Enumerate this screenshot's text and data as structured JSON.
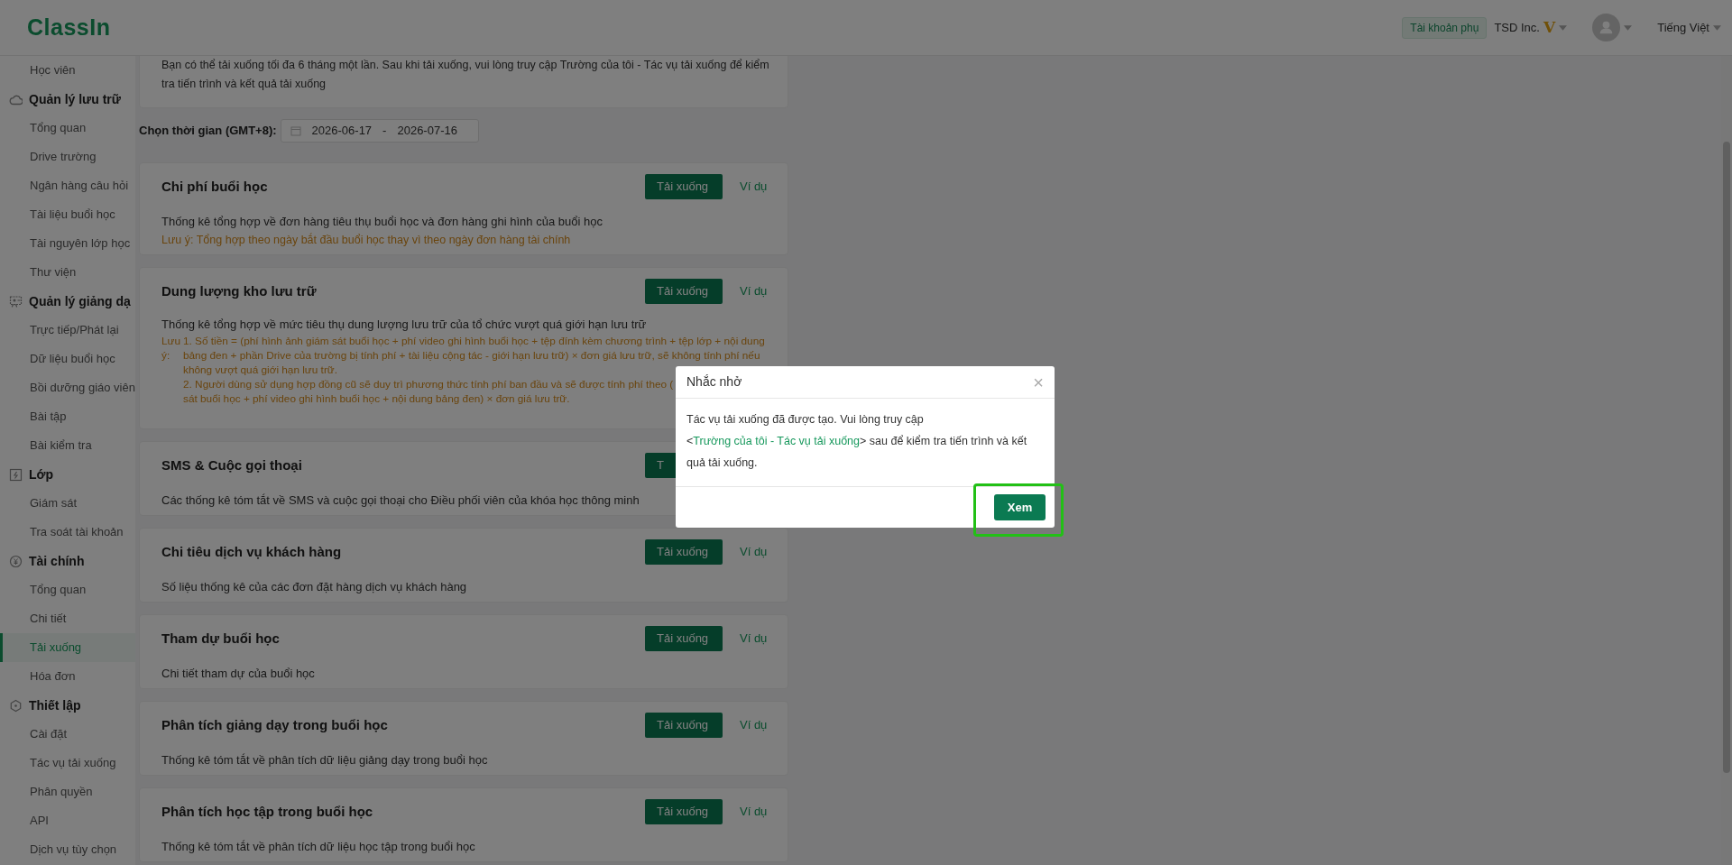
{
  "header": {
    "logo": "ClassIn",
    "account_badge": "Tài khoản phụ",
    "org": "TSD Inc.",
    "vip_mark": "V",
    "language": "Tiếng Việt"
  },
  "sidebar": {
    "items": [
      {
        "kind": "item",
        "label": "Học viên",
        "selected": false
      },
      {
        "kind": "group",
        "label": "Quản lý lưu trữ"
      },
      {
        "kind": "item",
        "label": "Tổng quan",
        "selected": false
      },
      {
        "kind": "item",
        "label": "Drive trường",
        "selected": false
      },
      {
        "kind": "item",
        "label": "Ngân hàng câu hỏi",
        "selected": false
      },
      {
        "kind": "item",
        "label": "Tài liệu buổi học",
        "selected": false
      },
      {
        "kind": "item",
        "label": "Tài nguyên lớp học",
        "selected": false
      },
      {
        "kind": "item",
        "label": "Thư viện",
        "selected": false
      },
      {
        "kind": "group",
        "label": "Quản lý giảng dạ"
      },
      {
        "kind": "item",
        "label": "Trực tiếp/Phát lại",
        "selected": false
      },
      {
        "kind": "item",
        "label": "Dữ liệu buổi học",
        "selected": false
      },
      {
        "kind": "item",
        "label": "Bồi dưỡng giáo viên",
        "selected": false
      },
      {
        "kind": "item",
        "label": "Bài tập",
        "selected": false
      },
      {
        "kind": "item",
        "label": "Bài kiểm tra",
        "selected": false
      },
      {
        "kind": "group",
        "label": "Lớp"
      },
      {
        "kind": "item",
        "label": "Giám sát",
        "selected": false
      },
      {
        "kind": "item",
        "label": "Tra soát tài khoản",
        "selected": false
      },
      {
        "kind": "group",
        "label": "Tài chính"
      },
      {
        "kind": "item",
        "label": "Tổng quan",
        "selected": false
      },
      {
        "kind": "item",
        "label": "Chi tiết",
        "selected": false
      },
      {
        "kind": "item",
        "label": "Tải xuống",
        "selected": true
      },
      {
        "kind": "item",
        "label": "Hóa đơn",
        "selected": false
      },
      {
        "kind": "group",
        "label": "Thiết lập"
      },
      {
        "kind": "item",
        "label": "Cài đặt",
        "selected": false
      },
      {
        "kind": "item",
        "label": "Tác vụ tải xuống",
        "selected": false
      },
      {
        "kind": "item",
        "label": "Phân quyền",
        "selected": false
      },
      {
        "kind": "item",
        "label": "API",
        "selected": false
      },
      {
        "kind": "item",
        "label": "Dịch vụ tùy chọn",
        "selected": false
      }
    ]
  },
  "notice": "Bạn có thể tải xuống tối đa 6 tháng một lần. Sau khi tải xuống, vui lòng truy cập Trường của tôi - Tác vụ tải xuống để kiểm tra tiến trình và kết quả tải xuống",
  "date_range": {
    "label": "Chọn thời gian (GMT+8):",
    "start": "2026-06-17",
    "separator": "-",
    "end": "2026-07-16"
  },
  "reports": [
    {
      "title": "Chi phí buổi học",
      "download": "Tải xuống",
      "example": "Ví dụ",
      "description": "Thống kê tổng hợp về đơn hàng tiêu thụ buổi học và đơn hàng ghi hình của buổi học",
      "note": "Lưu ý: Tổng hợp theo ngày bắt đầu buổi học thay vì theo ngày đơn hàng tài chính"
    },
    {
      "title": "Dung lượng kho lưu trữ",
      "download": "Tải xuống",
      "example": "Ví dụ",
      "description": "Thống kê tổng hợp về mức tiêu thụ dung lượng lưu trữ của tổ chức vượt quá giới hạn lưu trữ",
      "note_label": "Lưu ý:",
      "note_lines": [
        "1. Số tiền = (phí hình ảnh giám sát buổi học + phí video ghi hình buổi học + tệp đính kèm chương trình + tệp lớp + nội dung",
        "bảng đen + phần Drive của trường bị tính phí + tài liệu cộng tác - giới hạn lưu trữ) × đơn giá lưu trữ, sẽ không tính phí nếu",
        "không vượt quá giới hạn lưu trữ.",
        "2. Người dùng sử dụng hợp đồng cũ sẽ duy trì phương thức tính phí ban đầu và sẽ được tính phí theo (",
        "sát buổi học + phí video ghi hình buổi học + nội dung bảng đen) × đơn giá lưu trữ."
      ]
    },
    {
      "title": "SMS & Cuộc gọi thoại",
      "download": "T",
      "description": "Các thống kê tóm tắt về SMS và cuộc gọi thoại cho Điều phối viên của khóa học thông minh"
    },
    {
      "title": "Chi tiêu dịch vụ khách hàng",
      "download": "Tải xuống",
      "example": "Ví dụ",
      "description": "Số liệu thống kê của các đơn đặt hàng dịch vụ khách hàng"
    },
    {
      "title": "Tham dự buổi học",
      "download": "Tải xuống",
      "example": "Ví dụ",
      "description": "Chi tiết tham dự của buổi học"
    },
    {
      "title": "Phân tích giảng dạy trong buổi học",
      "download": "Tải xuống",
      "example": "Ví dụ",
      "description": "Thống kê tóm tắt về phân tích dữ liệu giảng dạy trong buổi học"
    },
    {
      "title": "Phân tích học tập trong buổi học",
      "download": "Tải xuống",
      "example": "Ví dụ",
      "description": "Thống kê tóm tắt về phân tích dữ liệu học tập trong buổi học"
    }
  ],
  "dialog": {
    "title": "Nhắc nhở",
    "close": "×",
    "text_before": "Tác vụ tải xuống đã được tạo. Vui lòng truy cập <",
    "link": "Trường của tôi - Tác vụ tải xuống",
    "text_after": "> sau để kiểm tra tiến trình và kết quả tải xuống.",
    "button": "Xem",
    "button_highlighted": true
  }
}
